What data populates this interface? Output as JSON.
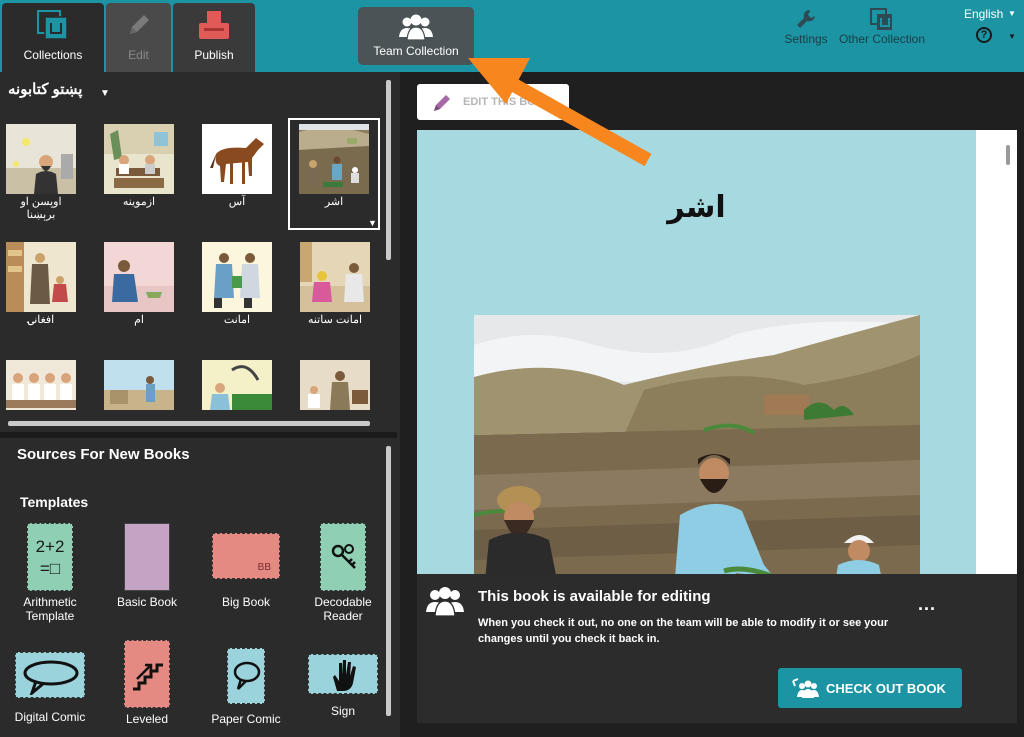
{
  "topbar": {
    "tabs": [
      {
        "label": "Collections",
        "icon": "collections-icon"
      },
      {
        "label": "Edit",
        "icon": "pencil-icon"
      },
      {
        "label": "Publish",
        "icon": "publish-icon"
      }
    ],
    "team_collection_label": "Team Collection",
    "settings_label": "Settings",
    "other_collection_label": "Other Collection",
    "language": "English",
    "help_symbol": "?"
  },
  "collection": {
    "title": "پښتو کتابونه",
    "books": [
      {
        "title": "اوپسن او برېښنا"
      },
      {
        "title": "ازموینه"
      },
      {
        "title": "آس"
      },
      {
        "title": "اشر"
      },
      {
        "title": "افغانۍ"
      },
      {
        "title": "ام"
      },
      {
        "title": "امانت"
      },
      {
        "title": "امانت ساتنه"
      },
      {
        "title": ""
      },
      {
        "title": ""
      },
      {
        "title": ""
      },
      {
        "title": ""
      }
    ],
    "selected_book": "اشر"
  },
  "sources": {
    "title": "Sources For New Books",
    "templates_title": "Templates",
    "templates": [
      {
        "label": "Arithmetic Template",
        "line1": "Arithmetic",
        "line2": "Template"
      },
      {
        "label": "Basic Book",
        "line1": "Basic Book",
        "line2": ""
      },
      {
        "label": "Big Book",
        "line1": "Big Book",
        "line2": ""
      },
      {
        "label": "Decodable Reader",
        "line1": "Decodable",
        "line2": "Reader"
      },
      {
        "label": "Digital Comic",
        "line1": "Digital Comic",
        "line2": ""
      },
      {
        "label": "Leveled",
        "line1": "Leveled",
        "line2": ""
      },
      {
        "label": "Paper Comic",
        "line1": "Paper Comic",
        "line2": ""
      },
      {
        "label": "Sign",
        "line1": "Sign",
        "line2": ""
      }
    ],
    "arithmetic_glyph": "2+2\n=□",
    "bigbook_glyph": "BB"
  },
  "preview": {
    "edit_button_label": "EDIT THIS BOOK",
    "book_title": "اشر"
  },
  "notice": {
    "title": "This book is available for editing",
    "text": "When you check it out, no one on the team will be able to modify it or see your changes until you check it back in.",
    "more": "...",
    "button_label": "CHECK OUT BOOK"
  },
  "colors": {
    "accent": "#1d94a4",
    "arrow": "#f7861f"
  }
}
